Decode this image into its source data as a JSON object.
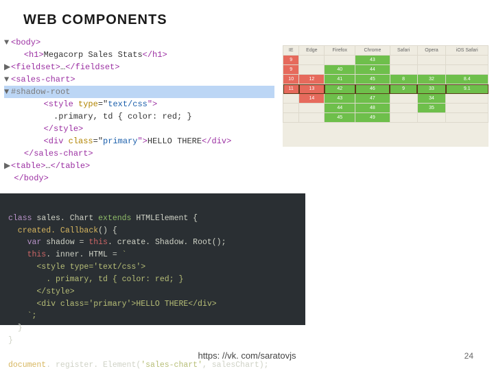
{
  "title": "WEB COMPONENTS",
  "footer_url": "https: //vk. com/saratovjs",
  "page_number": "24",
  "devtools": {
    "l1a": "▼ ",
    "l1b": "<body>",
    "l2": "<h1>",
    "l2t": "Megacorp Sales Stats",
    "l2c": "</h1>",
    "l3a": "▶ ",
    "l3b": "<fieldset>",
    "l3m": "…",
    "l3c": "</fieldset>",
    "l4a": "▼ ",
    "l4b": "<sales-chart>",
    "l5a": "▼   ",
    "l5b": "#shadow-root",
    "l6a": "        ",
    "l6b": "<style ",
    "l6c": "type",
    "l6d": "=\"",
    "l6e": "text/css",
    "l6f": "\">",
    "l7": "          .primary, td { color: red; }",
    "l8": "        </style>",
    "l9a": "        ",
    "l9b": "<div ",
    "l9c": "class",
    "l9d": "=\"",
    "l9e": "primary",
    "l9f": "\">",
    "l9g": "HELLO THERE",
    "l9h": "</div>",
    "l10a": "    ",
    "l10b": "</sales-chart>",
    "l11a": "▶ ",
    "l11b": "<table>",
    "l11m": "…",
    "l11c": "</table>",
    "l12": "  </body>"
  },
  "js": {
    "l1a": "class",
    "l1b": " sales. Chart ",
    "l1c": "extends",
    "l1d": " HTMLElement {",
    "l2a": "  created. Callback",
    "l2b": "() {",
    "l3a": "    var",
    "l3b": " shadow ",
    "l3c": "=",
    "l3d": " ",
    "l3e": "this",
    "l3f": ". create. Shadow. Root();",
    "l4a": "    this",
    "l4b": ". inner. HTML ",
    "l4c": "=",
    "l4d": " `",
    "l5": "      <style type='text/css'>",
    "l6": "        . primary, td { color: red; }",
    "l7": "      </style>",
    "l8": "      <div class='primary'>HELLO THERE</div>",
    "l9": "    `;",
    "l10": "  }",
    "l11": "}",
    "l12a": "document",
    "l12b": ". register. Element(",
    "l12c": "'sales-chart'",
    "l12d": ", salesChart);"
  },
  "compat": {
    "headers": [
      "IE",
      "Edge",
      "Firefox",
      "Chrome",
      "Safari",
      "Opera",
      "iOS Safari"
    ],
    "rows": [
      {
        "cells": [
          {
            "v": "9",
            "c": "red"
          },
          {
            "v": "",
            "c": "nocol"
          },
          {
            "v": "",
            "c": "nocol"
          },
          {
            "v": "43",
            "c": "grn"
          },
          {
            "v": "",
            "c": "nocol"
          },
          {
            "v": "",
            "c": "nocol"
          },
          {
            "v": "",
            "c": "nocol"
          }
        ]
      },
      {
        "cells": [
          {
            "v": "9",
            "c": "red"
          },
          {
            "v": "",
            "c": "nocol"
          },
          {
            "v": "40",
            "c": "grn"
          },
          {
            "v": "44",
            "c": "grn"
          },
          {
            "v": "",
            "c": "nocol"
          },
          {
            "v": "",
            "c": "nocol"
          },
          {
            "v": "",
            "c": "nocol"
          }
        ]
      },
      {
        "cells": [
          {
            "v": "10",
            "c": "red"
          },
          {
            "v": "12",
            "c": "red"
          },
          {
            "v": "41",
            "c": "grn"
          },
          {
            "v": "45",
            "c": "grn"
          },
          {
            "v": "8",
            "c": "grn"
          },
          {
            "v": "32",
            "c": "grn"
          },
          {
            "v": "8.4",
            "c": "grn"
          }
        ]
      },
      {
        "curr": true,
        "cells": [
          {
            "v": "11",
            "c": "red"
          },
          {
            "v": "13",
            "c": "red"
          },
          {
            "v": "42",
            "c": "grn"
          },
          {
            "v": "46",
            "c": "grn"
          },
          {
            "v": "9",
            "c": "grn"
          },
          {
            "v": "33",
            "c": "grn"
          },
          {
            "v": "9.1",
            "c": "grn"
          }
        ]
      },
      {
        "cells": [
          {
            "v": "",
            "c": "nocol"
          },
          {
            "v": "14",
            "c": "red"
          },
          {
            "v": "43",
            "c": "grn"
          },
          {
            "v": "47",
            "c": "grn"
          },
          {
            "v": "",
            "c": "nocol"
          },
          {
            "v": "34",
            "c": "grn"
          },
          {
            "v": "",
            "c": "nocol"
          }
        ]
      },
      {
        "cells": [
          {
            "v": "",
            "c": "nocol"
          },
          {
            "v": "",
            "c": "nocol"
          },
          {
            "v": "44",
            "c": "grn"
          },
          {
            "v": "48",
            "c": "grn"
          },
          {
            "v": "",
            "c": "nocol"
          },
          {
            "v": "35",
            "c": "grn"
          },
          {
            "v": "",
            "c": "nocol"
          }
        ]
      },
      {
        "cells": [
          {
            "v": "",
            "c": "nocol"
          },
          {
            "v": "",
            "c": "nocol"
          },
          {
            "v": "45",
            "c": "grn"
          },
          {
            "v": "49",
            "c": "grn"
          },
          {
            "v": "",
            "c": "nocol"
          },
          {
            "v": "",
            "c": "nocol"
          },
          {
            "v": "",
            "c": "nocol"
          }
        ]
      }
    ]
  }
}
